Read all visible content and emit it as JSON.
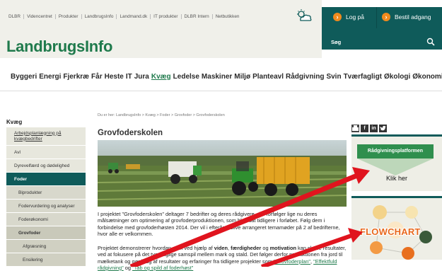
{
  "toplinks": [
    "DLBR",
    "Videncentret",
    "Produkter",
    "LandbrugsInfo",
    "Landmand.dk",
    "IT produkter",
    "DLBR Intern",
    "Netbutikken"
  ],
  "account": {
    "login_label": "Log på",
    "order_label": "Bestil adgang",
    "search_label": "Søg"
  },
  "logo": {
    "main": "Landbrugs",
    "accent": "Info"
  },
  "nav": [
    "Byggeri",
    "Energi",
    "Fjerkræ",
    "Får",
    "Heste",
    "IT",
    "Jura",
    "Kvæg",
    "Ledelse",
    "Maskiner",
    "Miljø",
    "Planteavl",
    "Rådgivning",
    "Svin",
    "Tværfagligt",
    "Økologi",
    "Økonomi"
  ],
  "nav_active": "Kvæg",
  "sidebar": {
    "title": "Kvæg",
    "items": [
      "Arbejdsplanlægning på kvægbedrifter",
      "Avl",
      "Dyrevelfærd og dødelighed",
      "Foder",
      "Biprodukter",
      "Fodervurdering og analyser",
      "Foderøkonomi",
      "Grovfoder",
      "Afgræsning",
      "Ensilering"
    ]
  },
  "breadcrumb": "Du er her: LandbrugsInfo > Kvæg > Foder > Grovfoder > Grovfoderskolen",
  "page_title": "Grovfoderskolen",
  "para1": "I projektet \"Grovfoderskolen\" deltager 7 bedrifter og deres rådgivere, der forfølger lige nu deres målsætninger om optimering af grovfoderproduktionen, som blev sat tidligere i forløbet. Følg dem i forbindelse med grovfoderhøsten 2014. Der vil i efteråret blive arrangeret temamøder på 2 af bedrifterne, hvor alle er velkommen.",
  "para2": {
    "before": "Projektet demonstrerer hvordan man ved hjælp af ",
    "b1": "viden",
    "sep1": ", ",
    "b2": "færdigheder",
    "sep2": " og ",
    "b3": "motivation",
    "after": " kan skabe resultater, ved at fokusere på det tværfaglige samspil mellem mark og stald. Det følger derfor produktionen fra jord til mælketank og gør brug af resultater og erfaringer fra tidligere projekter som ",
    "link1": "\"Grovfoderplan\"",
    "mid": ", ",
    "link2": "\"Effektfuld rådgivning\"",
    "and": " og ",
    "link3": "\"Tab og spild af foderhøst\""
  },
  "right": {
    "banner": "Rådgivningsplatformen",
    "klik": "Klik her",
    "flowchart": "FLOWCHART",
    "socials": [
      "print-icon",
      "facebook-icon",
      "linkedin-icon",
      "twitter-icon"
    ]
  },
  "colors": {
    "teal": "#0f5b5a",
    "green": "#1f7a4c",
    "orange": "#f18a1d",
    "arrow_red": "#e0141e"
  }
}
